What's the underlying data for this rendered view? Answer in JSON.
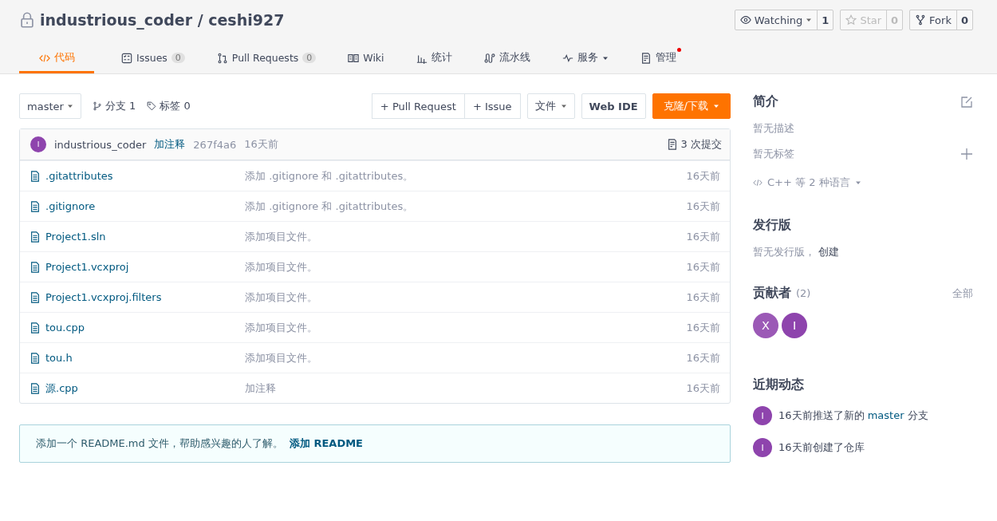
{
  "repo": {
    "owner": "industrious_coder",
    "separator": "/",
    "name": "ceshi927"
  },
  "repo_actions": [
    {
      "label": "Watching",
      "count": "1",
      "dropdown": true,
      "disabled": false
    },
    {
      "label": "Star",
      "count": "0",
      "dropdown": false,
      "disabled": true
    },
    {
      "label": "Fork",
      "count": "0",
      "dropdown": false,
      "disabled": false
    }
  ],
  "tabs": [
    {
      "label": "代码",
      "selected": true,
      "dropdown": false,
      "notice": false
    },
    {
      "label": "Issues",
      "count": "0",
      "selected": false,
      "dropdown": false,
      "notice": false
    },
    {
      "label": "Pull Requests",
      "count": "0",
      "selected": false,
      "dropdown": false,
      "notice": false
    },
    {
      "label": "Wiki",
      "selected": false,
      "dropdown": false,
      "notice": false
    },
    {
      "label": "统计",
      "selected": false,
      "dropdown": false,
      "notice": false
    },
    {
      "label": "流水线",
      "selected": false,
      "dropdown": false,
      "notice": false
    },
    {
      "label": "服务",
      "selected": false,
      "dropdown": true,
      "notice": false
    },
    {
      "label": "管理",
      "selected": false,
      "dropdown": false,
      "notice": true
    }
  ],
  "toolbar": {
    "branch": "master",
    "branches": "分支 1",
    "tags": "标签 0",
    "buttons": [
      {
        "label": "+ Pull Request",
        "kind": "group"
      },
      {
        "label": "+ Issue",
        "kind": "group"
      },
      {
        "label": "文件",
        "kind": "menu"
      },
      {
        "label": "Web IDE",
        "kind": "bold"
      },
      {
        "label": "克隆/下载",
        "kind": "primary"
      }
    ]
  },
  "last_commit": {
    "avatar": "I",
    "author": "industrious_coder",
    "message": "加注释",
    "hash": "267f4a6",
    "time": "16天前",
    "commits": "3 次提交"
  },
  "files": [
    {
      "name": ".gitattributes",
      "message": "添加 .gitignore 和 .gitattributes。",
      "time": "16天前"
    },
    {
      "name": ".gitignore",
      "message": "添加 .gitignore 和 .gitattributes。",
      "time": "16天前"
    },
    {
      "name": "Project1.sln",
      "message": "添加项目文件。",
      "time": "16天前"
    },
    {
      "name": "Project1.vcxproj",
      "message": "添加项目文件。",
      "time": "16天前"
    },
    {
      "name": "Project1.vcxproj.filters",
      "message": "添加项目文件。",
      "time": "16天前"
    },
    {
      "name": "tou.cpp",
      "message": "添加项目文件。",
      "time": "16天前"
    },
    {
      "name": "tou.h",
      "message": "添加项目文件。",
      "time": "16天前"
    },
    {
      "name": "源.cpp",
      "message": "加注释",
      "time": "16天前"
    }
  ],
  "readme_notice": {
    "text": "添加一个 README.md 文件，帮助感兴趣的人了解。",
    "link": "添加 README"
  },
  "sidebar": {
    "intro_title": "简介",
    "description": "暂无描述",
    "tags": "暂无标签",
    "languages": "C++ 等 2 种语言",
    "releases_title": "发行版",
    "releases_text": "暂无发行版，",
    "releases_link": "创建",
    "contributors_title": "贡献者",
    "contributors_count": "(2)",
    "contributors_all": "全部",
    "contributors": [
      {
        "initial": "X",
        "color": "#9b59b6"
      },
      {
        "initial": "I",
        "color": "#8e44ad"
      }
    ],
    "activity_title": "近期动态",
    "activity": [
      {
        "avatar": "I",
        "parts": [
          "16天前推送了新的",
          "master",
          "分支"
        ]
      },
      {
        "avatar": "I",
        "parts": [
          "16天前创建了仓库"
        ]
      }
    ]
  }
}
